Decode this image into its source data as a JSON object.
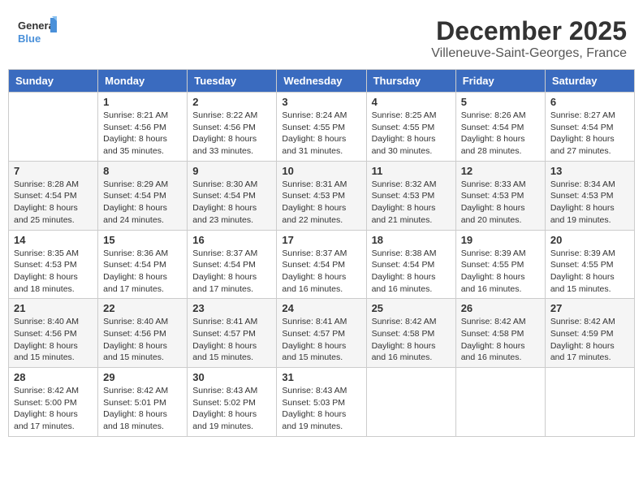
{
  "header": {
    "logo_line1": "General",
    "logo_line2": "Blue",
    "month": "December 2025",
    "location": "Villeneuve-Saint-Georges, France"
  },
  "weekdays": [
    "Sunday",
    "Monday",
    "Tuesday",
    "Wednesday",
    "Thursday",
    "Friday",
    "Saturday"
  ],
  "weeks": [
    [
      {
        "day": "",
        "info": ""
      },
      {
        "day": "1",
        "info": "Sunrise: 8:21 AM\nSunset: 4:56 PM\nDaylight: 8 hours\nand 35 minutes."
      },
      {
        "day": "2",
        "info": "Sunrise: 8:22 AM\nSunset: 4:56 PM\nDaylight: 8 hours\nand 33 minutes."
      },
      {
        "day": "3",
        "info": "Sunrise: 8:24 AM\nSunset: 4:55 PM\nDaylight: 8 hours\nand 31 minutes."
      },
      {
        "day": "4",
        "info": "Sunrise: 8:25 AM\nSunset: 4:55 PM\nDaylight: 8 hours\nand 30 minutes."
      },
      {
        "day": "5",
        "info": "Sunrise: 8:26 AM\nSunset: 4:54 PM\nDaylight: 8 hours\nand 28 minutes."
      },
      {
        "day": "6",
        "info": "Sunrise: 8:27 AM\nSunset: 4:54 PM\nDaylight: 8 hours\nand 27 minutes."
      }
    ],
    [
      {
        "day": "7",
        "info": "Sunrise: 8:28 AM\nSunset: 4:54 PM\nDaylight: 8 hours\nand 25 minutes."
      },
      {
        "day": "8",
        "info": "Sunrise: 8:29 AM\nSunset: 4:54 PM\nDaylight: 8 hours\nand 24 minutes."
      },
      {
        "day": "9",
        "info": "Sunrise: 8:30 AM\nSunset: 4:54 PM\nDaylight: 8 hours\nand 23 minutes."
      },
      {
        "day": "10",
        "info": "Sunrise: 8:31 AM\nSunset: 4:53 PM\nDaylight: 8 hours\nand 22 minutes."
      },
      {
        "day": "11",
        "info": "Sunrise: 8:32 AM\nSunset: 4:53 PM\nDaylight: 8 hours\nand 21 minutes."
      },
      {
        "day": "12",
        "info": "Sunrise: 8:33 AM\nSunset: 4:53 PM\nDaylight: 8 hours\nand 20 minutes."
      },
      {
        "day": "13",
        "info": "Sunrise: 8:34 AM\nSunset: 4:53 PM\nDaylight: 8 hours\nand 19 minutes."
      }
    ],
    [
      {
        "day": "14",
        "info": "Sunrise: 8:35 AM\nSunset: 4:53 PM\nDaylight: 8 hours\nand 18 minutes."
      },
      {
        "day": "15",
        "info": "Sunrise: 8:36 AM\nSunset: 4:54 PM\nDaylight: 8 hours\nand 17 minutes."
      },
      {
        "day": "16",
        "info": "Sunrise: 8:37 AM\nSunset: 4:54 PM\nDaylight: 8 hours\nand 17 minutes."
      },
      {
        "day": "17",
        "info": "Sunrise: 8:37 AM\nSunset: 4:54 PM\nDaylight: 8 hours\nand 16 minutes."
      },
      {
        "day": "18",
        "info": "Sunrise: 8:38 AM\nSunset: 4:54 PM\nDaylight: 8 hours\nand 16 minutes."
      },
      {
        "day": "19",
        "info": "Sunrise: 8:39 AM\nSunset: 4:55 PM\nDaylight: 8 hours\nand 16 minutes."
      },
      {
        "day": "20",
        "info": "Sunrise: 8:39 AM\nSunset: 4:55 PM\nDaylight: 8 hours\nand 15 minutes."
      }
    ],
    [
      {
        "day": "21",
        "info": "Sunrise: 8:40 AM\nSunset: 4:56 PM\nDaylight: 8 hours\nand 15 minutes."
      },
      {
        "day": "22",
        "info": "Sunrise: 8:40 AM\nSunset: 4:56 PM\nDaylight: 8 hours\nand 15 minutes."
      },
      {
        "day": "23",
        "info": "Sunrise: 8:41 AM\nSunset: 4:57 PM\nDaylight: 8 hours\nand 15 minutes."
      },
      {
        "day": "24",
        "info": "Sunrise: 8:41 AM\nSunset: 4:57 PM\nDaylight: 8 hours\nand 15 minutes."
      },
      {
        "day": "25",
        "info": "Sunrise: 8:42 AM\nSunset: 4:58 PM\nDaylight: 8 hours\nand 16 minutes."
      },
      {
        "day": "26",
        "info": "Sunrise: 8:42 AM\nSunset: 4:58 PM\nDaylight: 8 hours\nand 16 minutes."
      },
      {
        "day": "27",
        "info": "Sunrise: 8:42 AM\nSunset: 4:59 PM\nDaylight: 8 hours\nand 17 minutes."
      }
    ],
    [
      {
        "day": "28",
        "info": "Sunrise: 8:42 AM\nSunset: 5:00 PM\nDaylight: 8 hours\nand 17 minutes."
      },
      {
        "day": "29",
        "info": "Sunrise: 8:42 AM\nSunset: 5:01 PM\nDaylight: 8 hours\nand 18 minutes."
      },
      {
        "day": "30",
        "info": "Sunrise: 8:43 AM\nSunset: 5:02 PM\nDaylight: 8 hours\nand 19 minutes."
      },
      {
        "day": "31",
        "info": "Sunrise: 8:43 AM\nSunset: 5:03 PM\nDaylight: 8 hours\nand 19 minutes."
      },
      {
        "day": "",
        "info": ""
      },
      {
        "day": "",
        "info": ""
      },
      {
        "day": "",
        "info": ""
      }
    ]
  ]
}
